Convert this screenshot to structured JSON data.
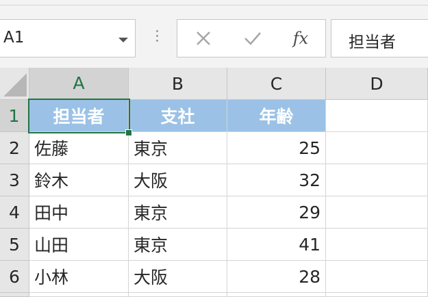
{
  "name_box": {
    "value": "A1"
  },
  "formula_bar": {
    "cancel_icon": "x-icon",
    "enter_icon": "check-icon",
    "fx_label": "fx",
    "content": "担当者"
  },
  "columns": [
    "A",
    "B",
    "C",
    "D"
  ],
  "rows": [
    "1",
    "2",
    "3",
    "4",
    "5",
    "6"
  ],
  "table": {
    "headers": [
      "担当者",
      "支社",
      "年齢"
    ],
    "data": [
      [
        "佐藤",
        "東京",
        "25"
      ],
      [
        "鈴木",
        "大阪",
        "32"
      ],
      [
        "田中",
        "東京",
        "29"
      ],
      [
        "山田",
        "東京",
        "41"
      ],
      [
        "小林",
        "大阪",
        "28"
      ]
    ]
  },
  "colors": {
    "accent": "#217346",
    "header_fill": "#9bc2e6"
  }
}
